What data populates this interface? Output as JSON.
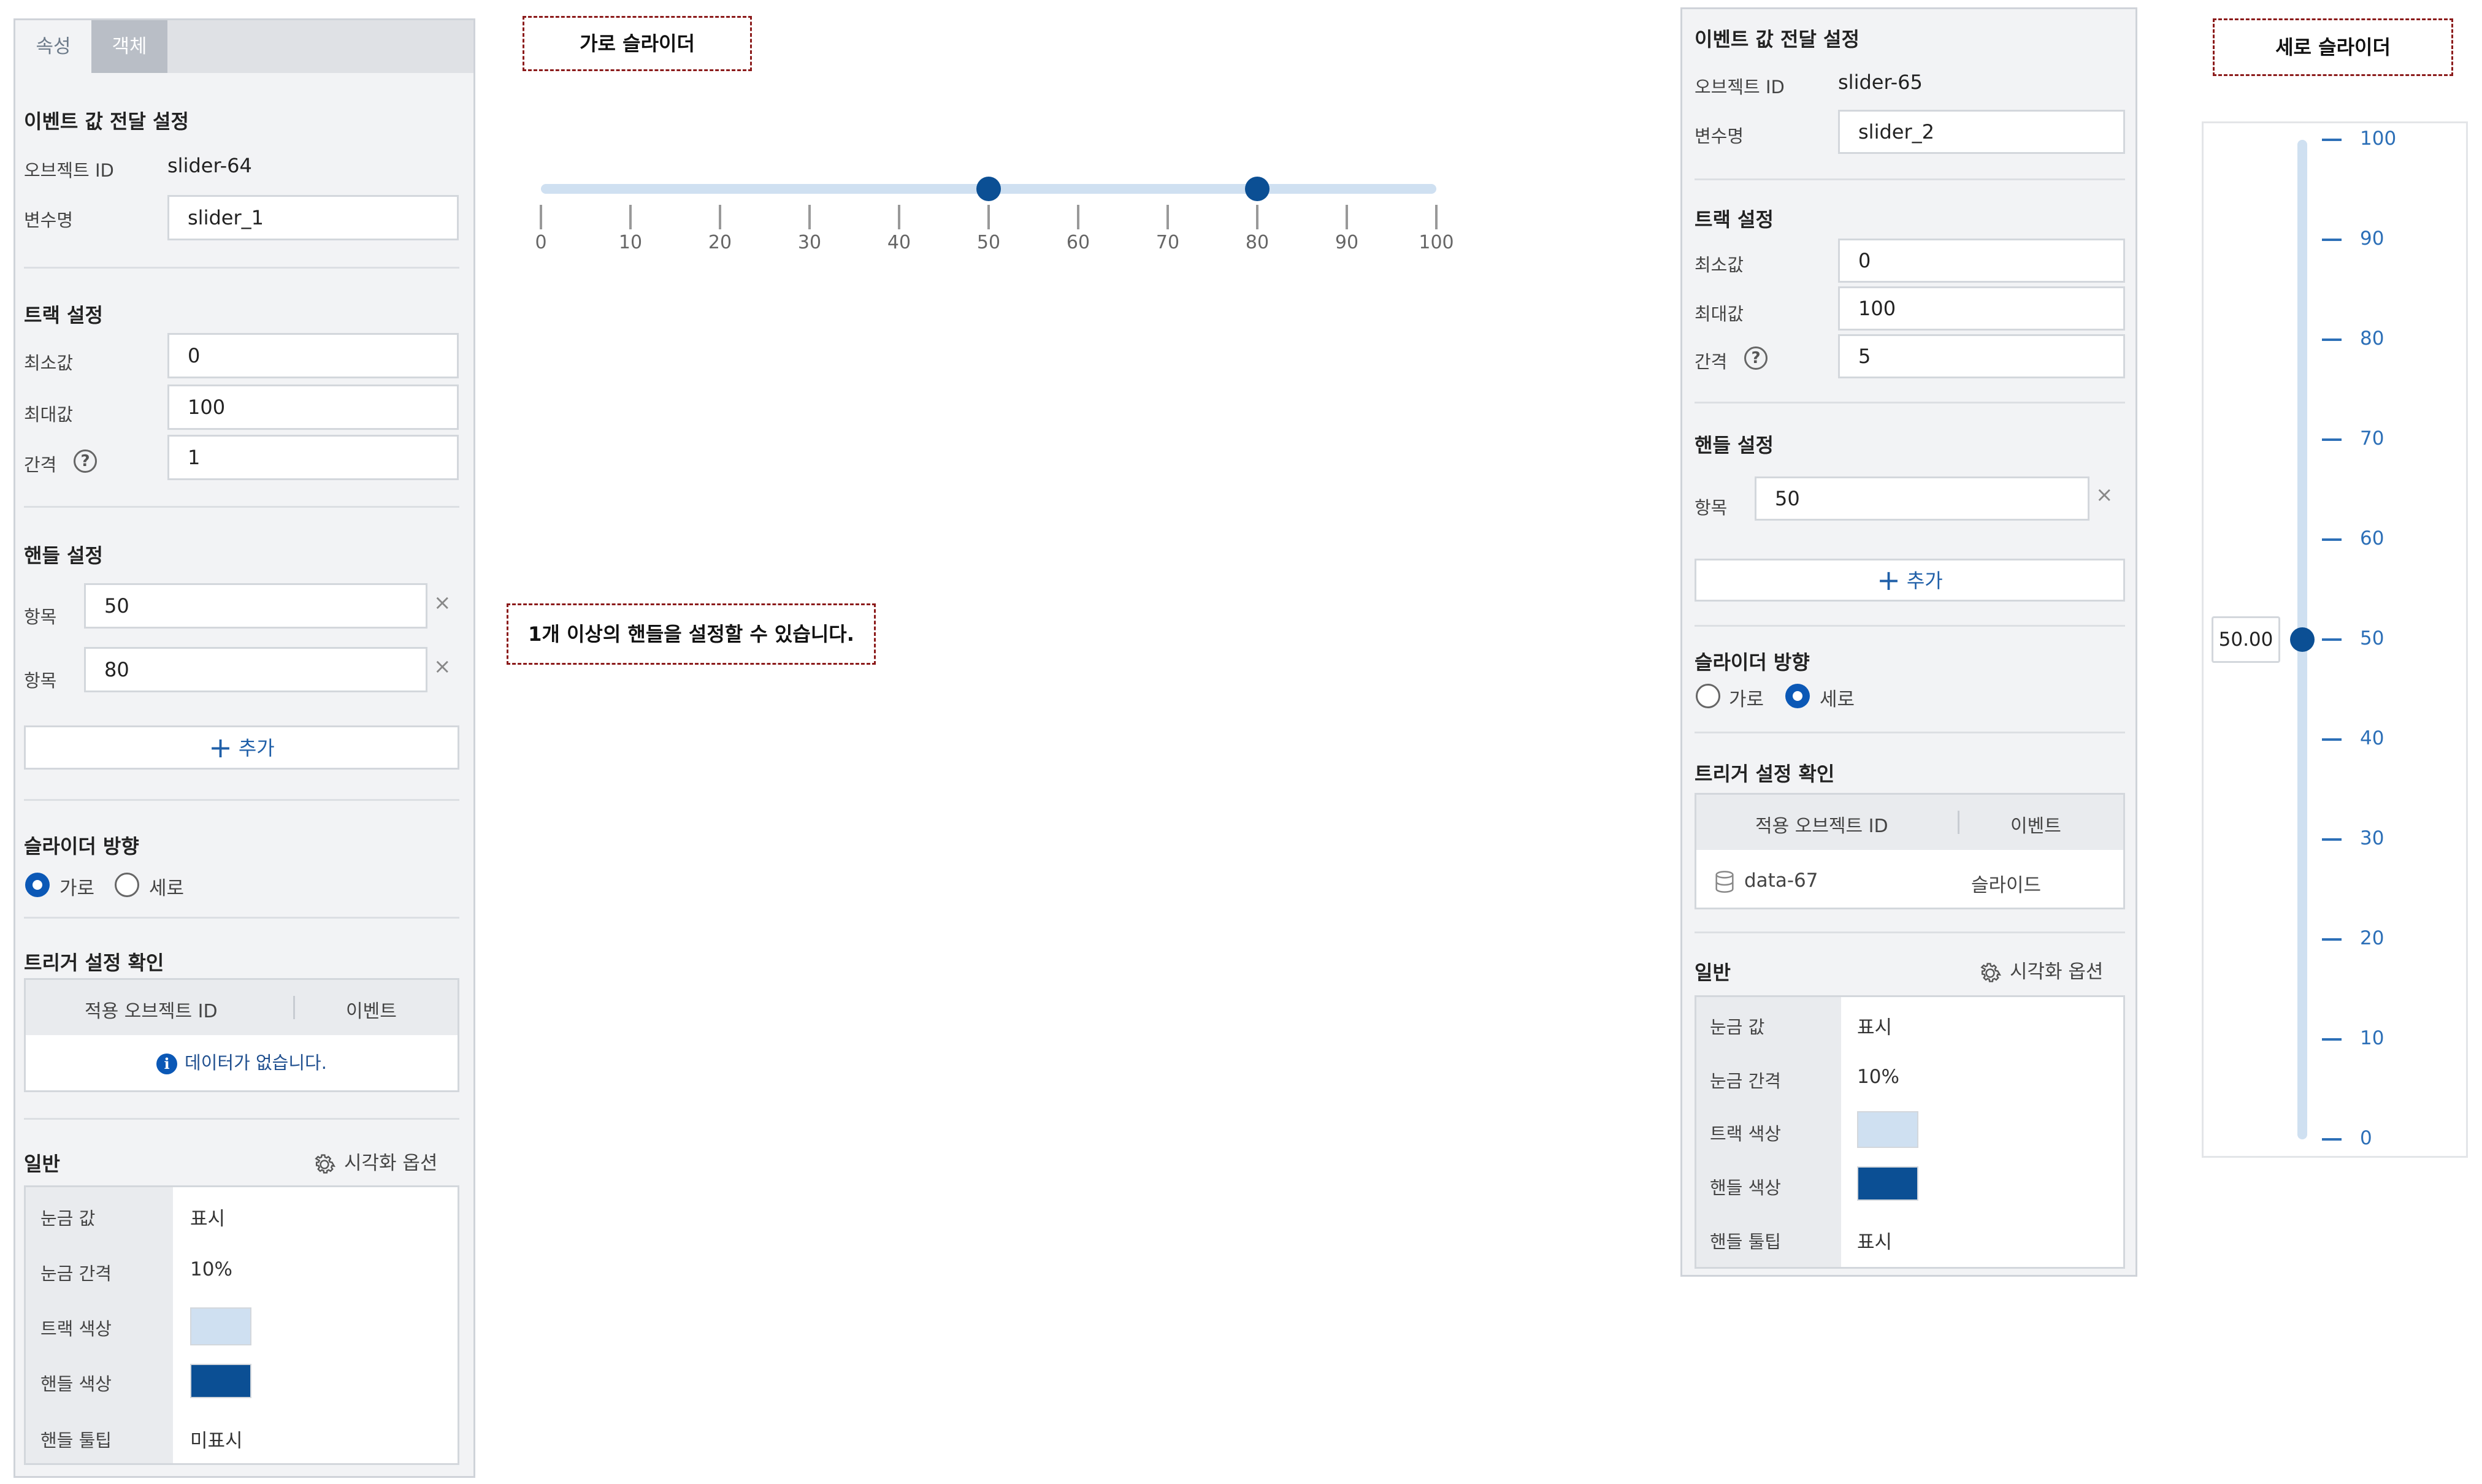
{
  "colors": {
    "track": "#cfe0f1",
    "handle": "#0b4f94",
    "accent": "#0b58b6",
    "note_border": "#8b1a1a"
  },
  "notes": {
    "horizontal": "가로 슬라이더",
    "vertical": "세로 슬라이더",
    "multi_handle": "1개 이상의 핸들을 설정할 수 있습니다."
  },
  "panel1": {
    "tabs": [
      "속성",
      "객체"
    ],
    "event_section": "이벤트 값 전달 설정",
    "object_id_label": "오브젝트 ID",
    "object_id": "slider-64",
    "var_label": "변수명",
    "var_value": "slider_1",
    "track_section": "트랙 설정",
    "min_label": "최소값",
    "min_value": "0",
    "max_label": "최대값",
    "max_value": "100",
    "step_label": "간격",
    "step_value": "1",
    "handle_section": "핸들 설정",
    "item_label": "항목",
    "handles": [
      "50",
      "80"
    ],
    "add_label": "추가",
    "direction_section": "슬라이더 방향",
    "dir_horizontal": "가로",
    "dir_vertical": "세로",
    "direction_selected": "horizontal",
    "trigger_section": "트리거 설정 확인",
    "col_object": "적용 오브젝트 ID",
    "col_event": "이벤트",
    "no_data": "데이터가 없습니다.",
    "general_section": "일반",
    "vis_option": "시각화 옵션",
    "tick_value_label": "눈금 값",
    "tick_value": "표시",
    "tick_interval_label": "눈금 간격",
    "tick_interval": "10%",
    "track_color_label": "트랙 색상",
    "handle_color_label": "핸들 색상",
    "tooltip_label": "핸들 툴팁",
    "tooltip_value": "미표시"
  },
  "panel2": {
    "event_section": "이벤트 값 전달 설정",
    "object_id_label": "오브젝트 ID",
    "object_id": "slider-65",
    "var_label": "변수명",
    "var_value": "slider_2",
    "track_section": "트랙 설정",
    "min_label": "최소값",
    "min_value": "0",
    "max_label": "최대값",
    "max_value": "100",
    "step_label": "간격",
    "step_value": "5",
    "handle_section": "핸들 설정",
    "item_label": "항목",
    "handles": [
      "50"
    ],
    "add_label": "추가",
    "direction_section": "슬라이더 방향",
    "dir_horizontal": "가로",
    "dir_vertical": "세로",
    "direction_selected": "vertical",
    "trigger_section": "트리거 설정 확인",
    "col_object": "적용 오브젝트 ID",
    "col_event": "이벤트",
    "trigger_rows": [
      {
        "object": "data-67",
        "event": "슬라이드"
      }
    ],
    "general_section": "일반",
    "vis_option": "시각화 옵션",
    "tick_value_label": "눈금 값",
    "tick_value": "표시",
    "tick_interval_label": "눈금 간격",
    "tick_interval": "10%",
    "track_color_label": "트랙 색상",
    "handle_color_label": "핸들 색상",
    "tooltip_label": "핸들 툴팁",
    "tooltip_value": "표시"
  },
  "h_slider": {
    "min": 0,
    "max": 100,
    "ticks": [
      "0",
      "10",
      "20",
      "30",
      "40",
      "50",
      "60",
      "70",
      "80",
      "90",
      "100"
    ],
    "handles": [
      50,
      80
    ]
  },
  "v_slider": {
    "min": 0,
    "max": 100,
    "ticks": [
      "0",
      "10",
      "20",
      "30",
      "40",
      "50",
      "60",
      "70",
      "80",
      "90",
      "100"
    ],
    "handle": 50,
    "tooltip": "50.00"
  }
}
